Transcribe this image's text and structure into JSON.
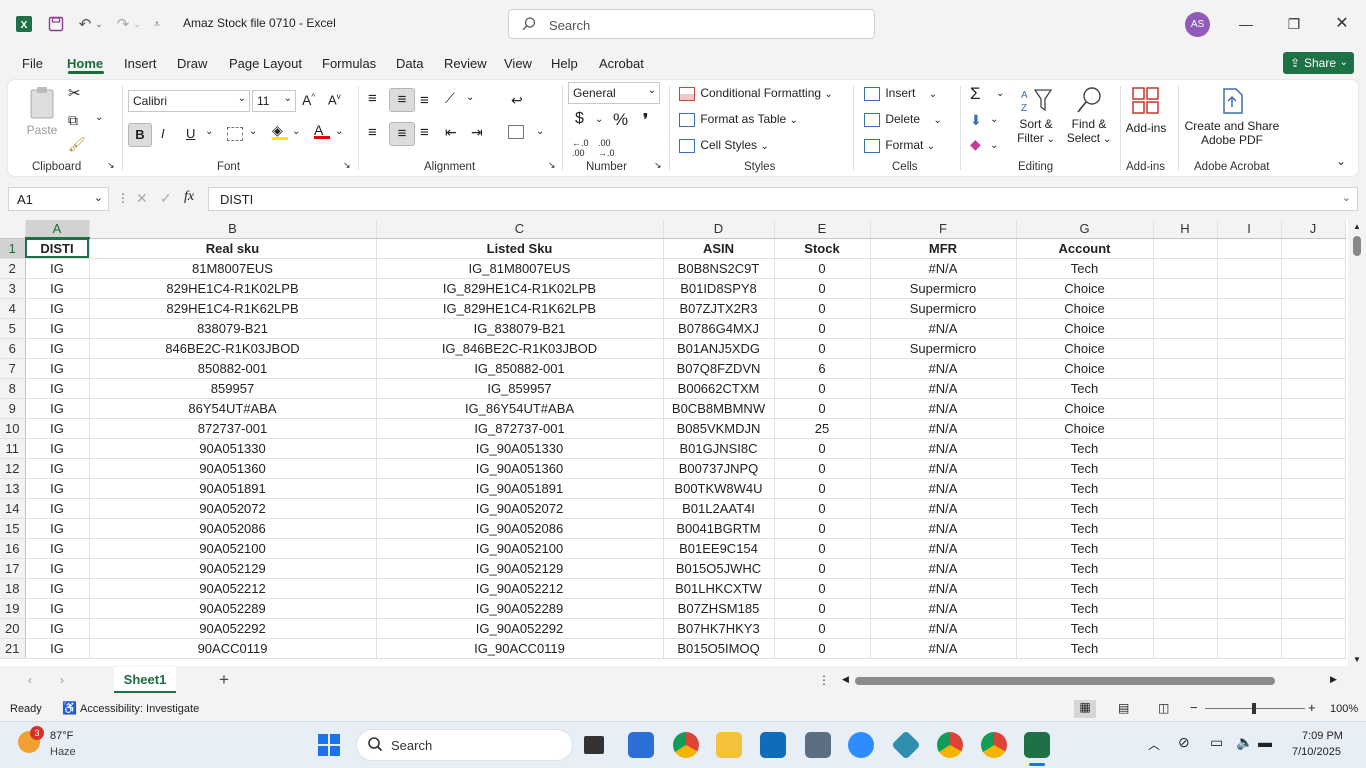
{
  "window": {
    "title": "Amaz Stock file 0710  -  Excel",
    "search_placeholder": "Search",
    "user_initials": "AS"
  },
  "menu": {
    "tabs": [
      "File",
      "Home",
      "Insert",
      "Draw",
      "Page Layout",
      "Formulas",
      "Data",
      "Review",
      "View",
      "Help",
      "Acrobat"
    ],
    "active": "Home",
    "share_label": "Share"
  },
  "ribbon": {
    "clipboard": {
      "paste": "Paste",
      "label": "Clipboard"
    },
    "font": {
      "name": "Calibri",
      "size": "11",
      "label": "Font",
      "bold": "B",
      "italic": "I",
      "underline": "U"
    },
    "alignment": {
      "label": "Alignment"
    },
    "number": {
      "format": "General",
      "label": "Number",
      "currency": "$",
      "percent": "%"
    },
    "styles": {
      "conditional": "Conditional Formatting",
      "format_table": "Format as Table",
      "cell_styles": "Cell Styles",
      "label": "Styles"
    },
    "cells": {
      "insert": "Insert",
      "delete": "Delete",
      "format": "Format",
      "label": "Cells"
    },
    "editing": {
      "sort_filter_1": "Sort &",
      "sort_filter_2": "Filter",
      "find_select_1": "Find &",
      "find_select_2": "Select",
      "label": "Editing"
    },
    "addins": {
      "button": "Add-ins",
      "label": "Add-ins"
    },
    "acrobat": {
      "button_1": "Create and Share",
      "button_2": "Adobe PDF",
      "label": "Adobe Acrobat"
    }
  },
  "formula_bar": {
    "name_box": "A1",
    "content": "DISTI"
  },
  "grid": {
    "columns": [
      "A",
      "B",
      "C",
      "D",
      "E",
      "F",
      "G",
      "H",
      "I",
      "J"
    ],
    "rows": [
      [
        "DISTI",
        "Real sku",
        "Listed Sku",
        "ASIN",
        "Stock",
        "MFR",
        "Account"
      ],
      [
        "IG",
        "81M8007EUS",
        "IG_81M8007EUS",
        "B0B8NS2C9T",
        "0",
        "#N/A",
        "Tech"
      ],
      [
        "IG",
        "829HE1C4-R1K02LPB",
        "IG_829HE1C4-R1K02LPB",
        "B01ID8SPY8",
        "0",
        "Supermicro",
        "Choice"
      ],
      [
        "IG",
        "829HE1C4-R1K62LPB",
        "IG_829HE1C4-R1K62LPB",
        "B07ZJTX2R3",
        "0",
        "Supermicro",
        "Choice"
      ],
      [
        "IG",
        "838079-B21",
        "IG_838079-B21",
        "B0786G4MXJ",
        "0",
        "#N/A",
        "Choice"
      ],
      [
        "IG",
        "846BE2C-R1K03JBOD",
        "IG_846BE2C-R1K03JBOD",
        "B01ANJ5XDG",
        "0",
        "Supermicro",
        "Choice"
      ],
      [
        "IG",
        "850882-001",
        "IG_850882-001",
        "B07Q8FZDVN",
        "6",
        "#N/A",
        "Choice"
      ],
      [
        "IG",
        "859957",
        "IG_859957",
        "B00662CTXM",
        "0",
        "#N/A",
        "Tech"
      ],
      [
        "IG",
        "86Y54UT#ABA",
        "IG_86Y54UT#ABA",
        "B0CB8MBMNW",
        "0",
        "#N/A",
        "Choice"
      ],
      [
        "IG",
        "872737-001",
        "IG_872737-001",
        "B085VKMDJN",
        "25",
        "#N/A",
        "Choice"
      ],
      [
        "IG",
        "90A051330",
        "IG_90A051330",
        "B01GJNSI8C",
        "0",
        "#N/A",
        "Tech"
      ],
      [
        "IG",
        "90A051360",
        "IG_90A051360",
        "B00737JNPQ",
        "0",
        "#N/A",
        "Tech"
      ],
      [
        "IG",
        "90A051891",
        "IG_90A051891",
        "B00TKW8W4U",
        "0",
        "#N/A",
        "Tech"
      ],
      [
        "IG",
        "90A052072",
        "IG_90A052072",
        "B01L2AAT4I",
        "0",
        "#N/A",
        "Tech"
      ],
      [
        "IG",
        "90A052086",
        "IG_90A052086",
        "B0041BGRTM",
        "0",
        "#N/A",
        "Tech"
      ],
      [
        "IG",
        "90A052100",
        "IG_90A052100",
        "B01EE9C154",
        "0",
        "#N/A",
        "Tech"
      ],
      [
        "IG",
        "90A052129",
        "IG_90A052129",
        "B015O5JWHC",
        "0",
        "#N/A",
        "Tech"
      ],
      [
        "IG",
        "90A052212",
        "IG_90A052212",
        "B01LHKCXTW",
        "0",
        "#N/A",
        "Tech"
      ],
      [
        "IG",
        "90A052289",
        "IG_90A052289",
        "B07ZHSM185",
        "0",
        "#N/A",
        "Tech"
      ],
      [
        "IG",
        "90A052292",
        "IG_90A052292",
        "B07HK7HKY3",
        "0",
        "#N/A",
        "Tech"
      ],
      [
        "IG",
        "90ACC0119",
        "IG_90ACC0119",
        "B015O5IMOQ",
        "0",
        "#N/A",
        "Tech"
      ]
    ]
  },
  "sheets": {
    "active": "Sheet1"
  },
  "status": {
    "ready": "Ready",
    "accessibility": "Accessibility: Investigate",
    "zoom": "100%"
  },
  "taskbar": {
    "weather_temp": "87°F",
    "weather_desc": "Haze",
    "weather_badge": "3",
    "search": "Search",
    "time": "7:09 PM",
    "date": "7/10/2025"
  },
  "colors": {
    "excel_green": "#1e7145",
    "accent": "#1c6b3d"
  }
}
